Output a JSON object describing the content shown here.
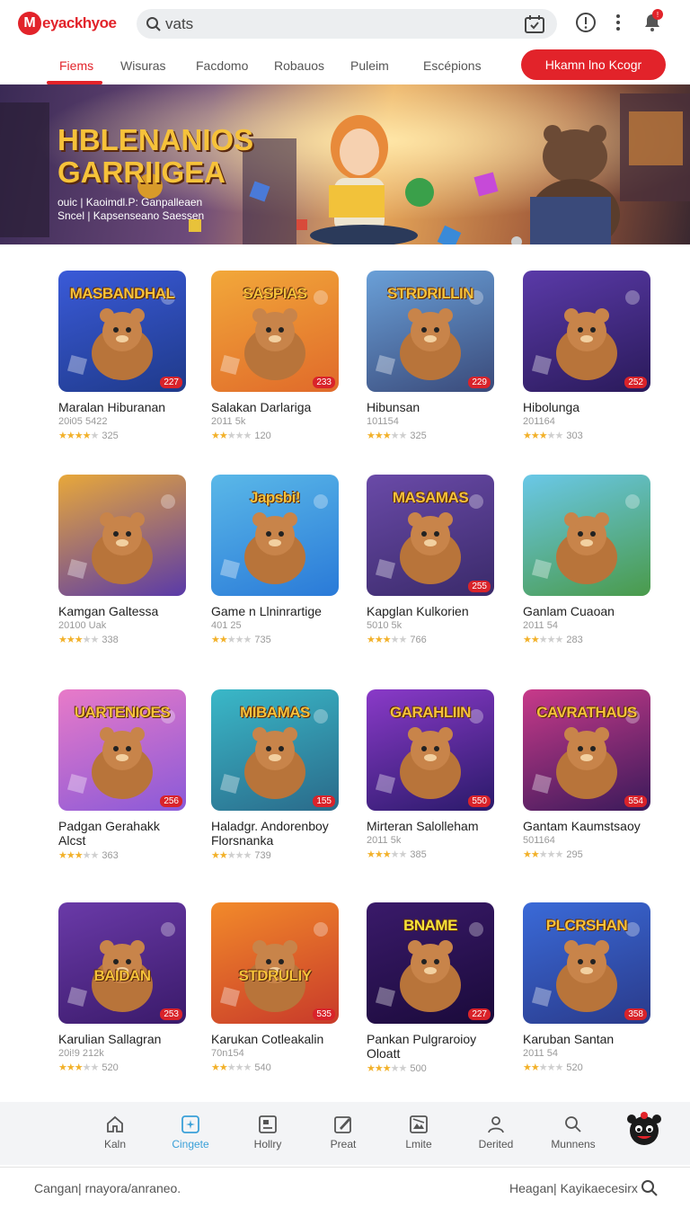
{
  "brand": {
    "mark": "M",
    "name": "eyackhyoe",
    "accent": "#e2232a"
  },
  "search": {
    "value": "vats"
  },
  "nav": {
    "tabs": [
      {
        "label": "Fiems",
        "active": true
      },
      {
        "label": "Wisuras"
      },
      {
        "label": "Facdomo"
      },
      {
        "label": "Robauos"
      },
      {
        "label": "Puleim"
      },
      {
        "label": "Escépions"
      }
    ],
    "cta": "Hkamn lno Kcogr"
  },
  "banner": {
    "title_line1": "HBLENANIOS",
    "title_line2": "GARRIIGEA",
    "sub_line1": "ouic | Kaoimdl.P: Ganpalleaen",
    "sub_line2": "Sncel | Kapsenseano Saessen"
  },
  "games": [
    {
      "title": "Maralan Hiburanan",
      "meta": "20i05 5422",
      "rating": 4,
      "count": "325",
      "badge": "227",
      "art": "MASBANDHAL"
    },
    {
      "title": "Salakan Darlariga",
      "meta": "2011 5k",
      "rating": 2,
      "count": "120",
      "badge": "233",
      "art": "SASPIAS"
    },
    {
      "title": "Hibunsan",
      "meta": "101154",
      "rating": 3,
      "count": "325",
      "badge": "229",
      "art": "STRDRILLIN"
    },
    {
      "title": "Hibolunga",
      "meta": "201164",
      "rating": 3,
      "count": "303",
      "badge": "252",
      "art": ""
    },
    {
      "title": "Kamgan Galtessa",
      "meta": "20100 Uak",
      "rating": 3,
      "count": "338",
      "badge": "",
      "art": ""
    },
    {
      "title": "Game n Llninrartige",
      "meta": "401 25",
      "rating": 2,
      "count": "735",
      "badge": "",
      "art": "Japsbi!"
    },
    {
      "title": "Kapglan Kulkorien",
      "meta": "5010 5k",
      "rating": 3,
      "count": "766",
      "badge": "255",
      "art": "MASAMAS"
    },
    {
      "title": "Ganlam Cuaoan",
      "meta": "2011 54",
      "rating": 2,
      "count": "283",
      "badge": "",
      "art": ""
    },
    {
      "title": "Padgan Gerahakk Alcst",
      "meta": "",
      "rating": 3,
      "count": "363",
      "badge": "256",
      "art": "UARTENIOES"
    },
    {
      "title": "Haladgr. Andorenboy Florsnanka",
      "meta": "",
      "rating": 2,
      "count": "739",
      "badge": "155",
      "art": "MIBAMAS"
    },
    {
      "title": "Mirteran Salolleham",
      "meta": "2011 5k",
      "rating": 3,
      "count": "385",
      "badge": "550",
      "art": "GARAHLIIN"
    },
    {
      "title": "Gantam Kaumstsaoy",
      "meta": "501164",
      "rating": 2,
      "count": "295",
      "badge": "554",
      "art": "CAVRATHAUS"
    },
    {
      "title": "Karulian Sallagran",
      "meta": "20i!9 212k",
      "rating": 3,
      "count": "520",
      "badge": "253",
      "art": "BAIDAN"
    },
    {
      "title": "Karukan Cotleakalin",
      "meta": "70n154",
      "rating": 2,
      "count": "540",
      "badge": "535",
      "art": "STDRULIY"
    },
    {
      "title": "Pankan Pulgraroioy Oloatt",
      "meta": "",
      "rating": 3,
      "count": "500",
      "badge": "227",
      "art": "BNAME"
    },
    {
      "title": "Karuban Santan",
      "meta": "2011 54",
      "rating": 2,
      "count": "520",
      "badge": "358",
      "art": "PLCRSHAN"
    }
  ],
  "bottom_nav": [
    {
      "label": "Kaln",
      "icon": "home-icon"
    },
    {
      "label": "Cingete",
      "icon": "sparkle-card-icon",
      "active": true
    },
    {
      "label": "Hollry",
      "icon": "media-card-icon"
    },
    {
      "label": "Preat",
      "icon": "edit-icon"
    },
    {
      "label": "Lmite",
      "icon": "gallery-icon"
    },
    {
      "label": "Derited",
      "icon": "user-icon"
    },
    {
      "label": "Munnens",
      "icon": "search-icon"
    }
  ],
  "footer": {
    "left": "Cangan| rnayora/anraneo.",
    "right": "Heagan| Kayikaecesirx"
  },
  "notifications": {
    "count": "!"
  }
}
